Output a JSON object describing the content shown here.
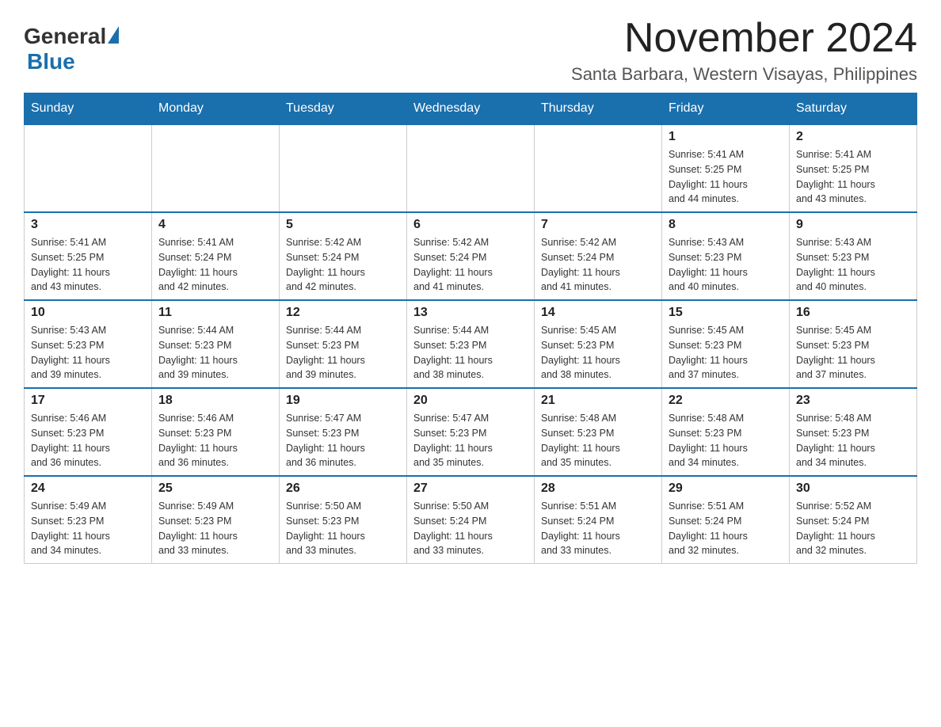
{
  "header": {
    "title": "November 2024",
    "subtitle": "Santa Barbara, Western Visayas, Philippines",
    "logo": {
      "general": "General",
      "blue": "Blue"
    }
  },
  "days_of_week": [
    "Sunday",
    "Monday",
    "Tuesday",
    "Wednesday",
    "Thursday",
    "Friday",
    "Saturday"
  ],
  "weeks": [
    [
      {
        "day": "",
        "info": ""
      },
      {
        "day": "",
        "info": ""
      },
      {
        "day": "",
        "info": ""
      },
      {
        "day": "",
        "info": ""
      },
      {
        "day": "",
        "info": ""
      },
      {
        "day": "1",
        "info": "Sunrise: 5:41 AM\nSunset: 5:25 PM\nDaylight: 11 hours\nand 44 minutes."
      },
      {
        "day": "2",
        "info": "Sunrise: 5:41 AM\nSunset: 5:25 PM\nDaylight: 11 hours\nand 43 minutes."
      }
    ],
    [
      {
        "day": "3",
        "info": "Sunrise: 5:41 AM\nSunset: 5:25 PM\nDaylight: 11 hours\nand 43 minutes."
      },
      {
        "day": "4",
        "info": "Sunrise: 5:41 AM\nSunset: 5:24 PM\nDaylight: 11 hours\nand 42 minutes."
      },
      {
        "day": "5",
        "info": "Sunrise: 5:42 AM\nSunset: 5:24 PM\nDaylight: 11 hours\nand 42 minutes."
      },
      {
        "day": "6",
        "info": "Sunrise: 5:42 AM\nSunset: 5:24 PM\nDaylight: 11 hours\nand 41 minutes."
      },
      {
        "day": "7",
        "info": "Sunrise: 5:42 AM\nSunset: 5:24 PM\nDaylight: 11 hours\nand 41 minutes."
      },
      {
        "day": "8",
        "info": "Sunrise: 5:43 AM\nSunset: 5:23 PM\nDaylight: 11 hours\nand 40 minutes."
      },
      {
        "day": "9",
        "info": "Sunrise: 5:43 AM\nSunset: 5:23 PM\nDaylight: 11 hours\nand 40 minutes."
      }
    ],
    [
      {
        "day": "10",
        "info": "Sunrise: 5:43 AM\nSunset: 5:23 PM\nDaylight: 11 hours\nand 39 minutes."
      },
      {
        "day": "11",
        "info": "Sunrise: 5:44 AM\nSunset: 5:23 PM\nDaylight: 11 hours\nand 39 minutes."
      },
      {
        "day": "12",
        "info": "Sunrise: 5:44 AM\nSunset: 5:23 PM\nDaylight: 11 hours\nand 39 minutes."
      },
      {
        "day": "13",
        "info": "Sunrise: 5:44 AM\nSunset: 5:23 PM\nDaylight: 11 hours\nand 38 minutes."
      },
      {
        "day": "14",
        "info": "Sunrise: 5:45 AM\nSunset: 5:23 PM\nDaylight: 11 hours\nand 38 minutes."
      },
      {
        "day": "15",
        "info": "Sunrise: 5:45 AM\nSunset: 5:23 PM\nDaylight: 11 hours\nand 37 minutes."
      },
      {
        "day": "16",
        "info": "Sunrise: 5:45 AM\nSunset: 5:23 PM\nDaylight: 11 hours\nand 37 minutes."
      }
    ],
    [
      {
        "day": "17",
        "info": "Sunrise: 5:46 AM\nSunset: 5:23 PM\nDaylight: 11 hours\nand 36 minutes."
      },
      {
        "day": "18",
        "info": "Sunrise: 5:46 AM\nSunset: 5:23 PM\nDaylight: 11 hours\nand 36 minutes."
      },
      {
        "day": "19",
        "info": "Sunrise: 5:47 AM\nSunset: 5:23 PM\nDaylight: 11 hours\nand 36 minutes."
      },
      {
        "day": "20",
        "info": "Sunrise: 5:47 AM\nSunset: 5:23 PM\nDaylight: 11 hours\nand 35 minutes."
      },
      {
        "day": "21",
        "info": "Sunrise: 5:48 AM\nSunset: 5:23 PM\nDaylight: 11 hours\nand 35 minutes."
      },
      {
        "day": "22",
        "info": "Sunrise: 5:48 AM\nSunset: 5:23 PM\nDaylight: 11 hours\nand 34 minutes."
      },
      {
        "day": "23",
        "info": "Sunrise: 5:48 AM\nSunset: 5:23 PM\nDaylight: 11 hours\nand 34 minutes."
      }
    ],
    [
      {
        "day": "24",
        "info": "Sunrise: 5:49 AM\nSunset: 5:23 PM\nDaylight: 11 hours\nand 34 minutes."
      },
      {
        "day": "25",
        "info": "Sunrise: 5:49 AM\nSunset: 5:23 PM\nDaylight: 11 hours\nand 33 minutes."
      },
      {
        "day": "26",
        "info": "Sunrise: 5:50 AM\nSunset: 5:23 PM\nDaylight: 11 hours\nand 33 minutes."
      },
      {
        "day": "27",
        "info": "Sunrise: 5:50 AM\nSunset: 5:24 PM\nDaylight: 11 hours\nand 33 minutes."
      },
      {
        "day": "28",
        "info": "Sunrise: 5:51 AM\nSunset: 5:24 PM\nDaylight: 11 hours\nand 33 minutes."
      },
      {
        "day": "29",
        "info": "Sunrise: 5:51 AM\nSunset: 5:24 PM\nDaylight: 11 hours\nand 32 minutes."
      },
      {
        "day": "30",
        "info": "Sunrise: 5:52 AM\nSunset: 5:24 PM\nDaylight: 11 hours\nand 32 minutes."
      }
    ]
  ]
}
